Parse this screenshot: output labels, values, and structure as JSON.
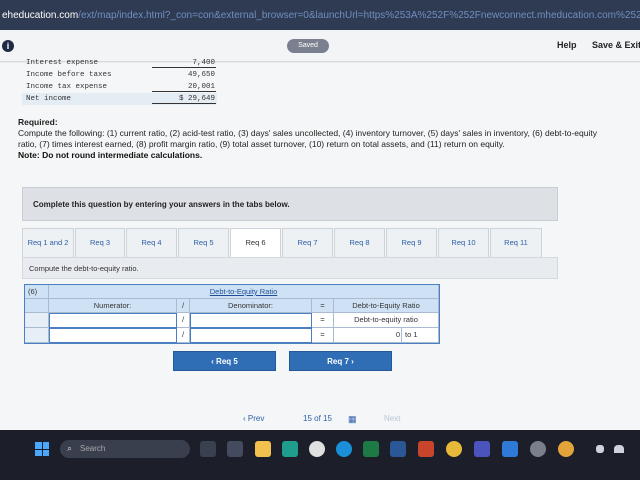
{
  "browser": {
    "host": "eheducation.com",
    "path": "/ext/map/index.html?_con=con&external_browser=0&launchUrl=https%253A%252F%252Fnewconnect.mheducation.com%252F#activity/q..."
  },
  "toolbar": {
    "saved_label": "Saved",
    "help_label": "Help",
    "save_exit_label": "Save & Exit",
    "info_icon": "i"
  },
  "income_statement": {
    "rows": [
      {
        "label": "Interest expense",
        "amount": "7,400"
      },
      {
        "label": "Income before taxes",
        "amount": "49,650"
      },
      {
        "label": "Income tax expense",
        "amount": "20,001"
      },
      {
        "label": "Net income",
        "amount": "$ 29,649"
      }
    ]
  },
  "required": {
    "title": "Required:",
    "body": "Compute the following: (1) current ratio, (2) acid-test ratio, (3) days' sales uncollected, (4) inventory turnover, (5) days' sales in inventory, (6) debt-to-equity ratio, (7) times interest earned, (8) profit margin ratio, (9) total asset turnover, (10) return on total assets, and (11) return on equity.",
    "note": "Note: Do not round intermediate calculations."
  },
  "instruction": "Complete this question by entering your answers in the tabs below.",
  "tabs": [
    "Req 1 and 2",
    "Req 3",
    "Req 4",
    "Req 5",
    "Req 6",
    "Req 7",
    "Req 8",
    "Req 9",
    "Req 10",
    "Req 11"
  ],
  "active_tab": "Req 6",
  "subtitle": "Compute the debt-to-equity ratio.",
  "ratio_table": {
    "row_number": "(6)",
    "title": "Debt-to-Equity Ratio",
    "numerator_header": "Numerator:",
    "slash": "/",
    "denominator_header": "Denominator:",
    "equals": "=",
    "result_header": "Debt-to-Equity Ratio",
    "row1_result": "Debt-to-equity ratio",
    "row2_result_value": "0",
    "row2_result_suffix": "to 1"
  },
  "nav": {
    "prev_label": "‹  Req 5",
    "next_label": "Req 7  ›"
  },
  "pager": {
    "prev": "‹  Prev",
    "count": "15  of  15",
    "next": "Next"
  },
  "taskbar": {
    "search_placeholder": "Search"
  },
  "colors": {
    "accent": "#2f6db5",
    "header_blue": "#cfe2f5",
    "taskbar": "#1c1f2a"
  }
}
